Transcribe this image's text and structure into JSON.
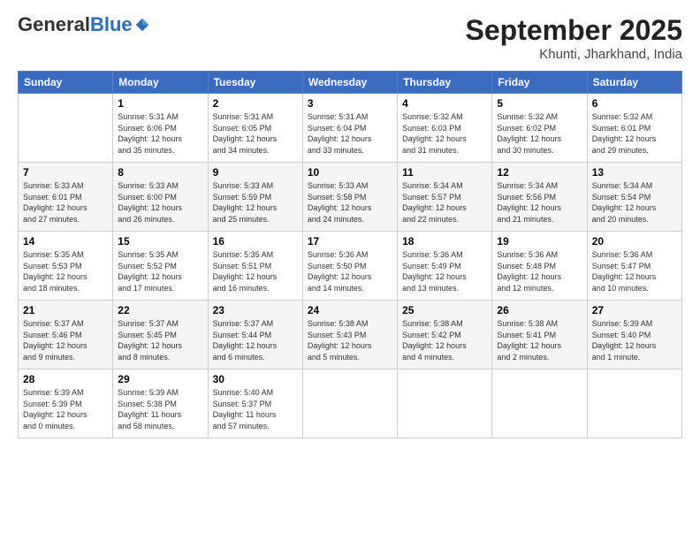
{
  "logo": {
    "general": "General",
    "blue": "Blue"
  },
  "header": {
    "month": "September 2025",
    "location": "Khunti, Jharkhand, India"
  },
  "days_of_week": [
    "Sunday",
    "Monday",
    "Tuesday",
    "Wednesday",
    "Thursday",
    "Friday",
    "Saturday"
  ],
  "weeks": [
    [
      {
        "day": "",
        "info": ""
      },
      {
        "day": "1",
        "info": "Sunrise: 5:31 AM\nSunset: 6:06 PM\nDaylight: 12 hours\nand 35 minutes."
      },
      {
        "day": "2",
        "info": "Sunrise: 5:31 AM\nSunset: 6:05 PM\nDaylight: 12 hours\nand 34 minutes."
      },
      {
        "day": "3",
        "info": "Sunrise: 5:31 AM\nSunset: 6:04 PM\nDaylight: 12 hours\nand 33 minutes."
      },
      {
        "day": "4",
        "info": "Sunrise: 5:32 AM\nSunset: 6:03 PM\nDaylight: 12 hours\nand 31 minutes."
      },
      {
        "day": "5",
        "info": "Sunrise: 5:32 AM\nSunset: 6:02 PM\nDaylight: 12 hours\nand 30 minutes."
      },
      {
        "day": "6",
        "info": "Sunrise: 5:32 AM\nSunset: 6:01 PM\nDaylight: 12 hours\nand 29 minutes."
      }
    ],
    [
      {
        "day": "7",
        "info": "Sunrise: 5:33 AM\nSunset: 6:01 PM\nDaylight: 12 hours\nand 27 minutes."
      },
      {
        "day": "8",
        "info": "Sunrise: 5:33 AM\nSunset: 6:00 PM\nDaylight: 12 hours\nand 26 minutes."
      },
      {
        "day": "9",
        "info": "Sunrise: 5:33 AM\nSunset: 5:59 PM\nDaylight: 12 hours\nand 25 minutes."
      },
      {
        "day": "10",
        "info": "Sunrise: 5:33 AM\nSunset: 5:58 PM\nDaylight: 12 hours\nand 24 minutes."
      },
      {
        "day": "11",
        "info": "Sunrise: 5:34 AM\nSunset: 5:57 PM\nDaylight: 12 hours\nand 22 minutes."
      },
      {
        "day": "12",
        "info": "Sunrise: 5:34 AM\nSunset: 5:56 PM\nDaylight: 12 hours\nand 21 minutes."
      },
      {
        "day": "13",
        "info": "Sunrise: 5:34 AM\nSunset: 5:54 PM\nDaylight: 12 hours\nand 20 minutes."
      }
    ],
    [
      {
        "day": "14",
        "info": "Sunrise: 5:35 AM\nSunset: 5:53 PM\nDaylight: 12 hours\nand 18 minutes."
      },
      {
        "day": "15",
        "info": "Sunrise: 5:35 AM\nSunset: 5:52 PM\nDaylight: 12 hours\nand 17 minutes."
      },
      {
        "day": "16",
        "info": "Sunrise: 5:35 AM\nSunset: 5:51 PM\nDaylight: 12 hours\nand 16 minutes."
      },
      {
        "day": "17",
        "info": "Sunrise: 5:36 AM\nSunset: 5:50 PM\nDaylight: 12 hours\nand 14 minutes."
      },
      {
        "day": "18",
        "info": "Sunrise: 5:36 AM\nSunset: 5:49 PM\nDaylight: 12 hours\nand 13 minutes."
      },
      {
        "day": "19",
        "info": "Sunrise: 5:36 AM\nSunset: 5:48 PM\nDaylight: 12 hours\nand 12 minutes."
      },
      {
        "day": "20",
        "info": "Sunrise: 5:36 AM\nSunset: 5:47 PM\nDaylight: 12 hours\nand 10 minutes."
      }
    ],
    [
      {
        "day": "21",
        "info": "Sunrise: 5:37 AM\nSunset: 5:46 PM\nDaylight: 12 hours\nand 9 minutes."
      },
      {
        "day": "22",
        "info": "Sunrise: 5:37 AM\nSunset: 5:45 PM\nDaylight: 12 hours\nand 8 minutes."
      },
      {
        "day": "23",
        "info": "Sunrise: 5:37 AM\nSunset: 5:44 PM\nDaylight: 12 hours\nand 6 minutes."
      },
      {
        "day": "24",
        "info": "Sunrise: 5:38 AM\nSunset: 5:43 PM\nDaylight: 12 hours\nand 5 minutes."
      },
      {
        "day": "25",
        "info": "Sunrise: 5:38 AM\nSunset: 5:42 PM\nDaylight: 12 hours\nand 4 minutes."
      },
      {
        "day": "26",
        "info": "Sunrise: 5:38 AM\nSunset: 5:41 PM\nDaylight: 12 hours\nand 2 minutes."
      },
      {
        "day": "27",
        "info": "Sunrise: 5:39 AM\nSunset: 5:40 PM\nDaylight: 12 hours\nand 1 minute."
      }
    ],
    [
      {
        "day": "28",
        "info": "Sunrise: 5:39 AM\nSunset: 5:39 PM\nDaylight: 12 hours\nand 0 minutes."
      },
      {
        "day": "29",
        "info": "Sunrise: 5:39 AM\nSunset: 5:38 PM\nDaylight: 11 hours\nand 58 minutes."
      },
      {
        "day": "30",
        "info": "Sunrise: 5:40 AM\nSunset: 5:37 PM\nDaylight: 11 hours\nand 57 minutes."
      },
      {
        "day": "",
        "info": ""
      },
      {
        "day": "",
        "info": ""
      },
      {
        "day": "",
        "info": ""
      },
      {
        "day": "",
        "info": ""
      }
    ]
  ]
}
